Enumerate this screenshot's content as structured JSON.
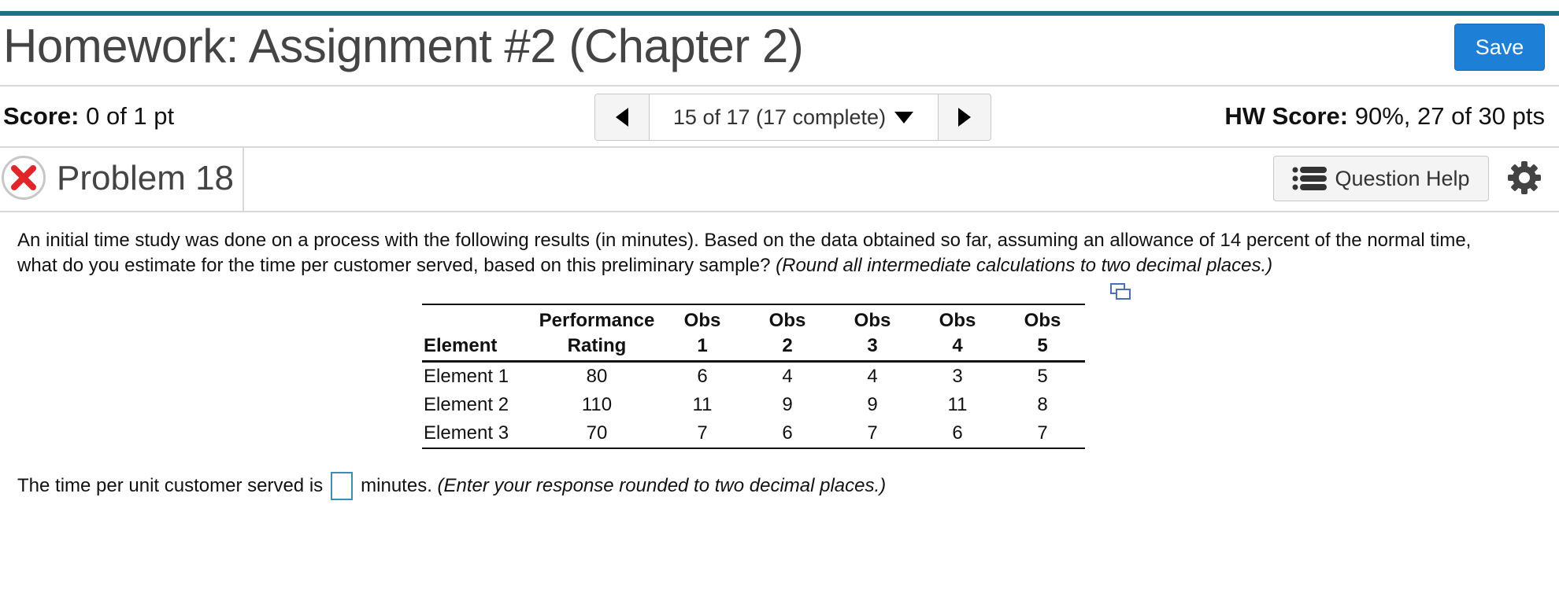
{
  "header": {
    "title": "Homework: Assignment #2 (Chapter 2)",
    "save_label": "Save"
  },
  "score": {
    "label": "Score:",
    "value": "0 of 1 pt"
  },
  "nav": {
    "position": "15 of 17 (17 complete)"
  },
  "hw_score": {
    "label": "HW Score:",
    "value": "90%, 27 of 30 pts"
  },
  "problem": {
    "title": "Problem 18",
    "help_label": "Question Help"
  },
  "question": {
    "text": "An initial time study was done on a process with the following results (in minutes). Based on the data obtained so far, assuming an allowance of 14 percent of the normal time, what do you estimate for the time per customer served, based on this preliminary sample? ",
    "instruction": "(Round all intermediate calculations to two decimal places.)"
  },
  "table": {
    "headers": {
      "element": "Element",
      "rating_top": "Performance",
      "rating_bottom": "Rating",
      "obs_top": "Obs",
      "obs_numbers": [
        "1",
        "2",
        "3",
        "4",
        "5"
      ]
    },
    "rows": [
      {
        "element": "Element 1",
        "rating": "80",
        "obs": [
          "6",
          "4",
          "4",
          "3",
          "5"
        ]
      },
      {
        "element": "Element 2",
        "rating": "110",
        "obs": [
          "11",
          "9",
          "9",
          "11",
          "8"
        ]
      },
      {
        "element": "Element 3",
        "rating": "70",
        "obs": [
          "7",
          "6",
          "7",
          "6",
          "7"
        ]
      }
    ]
  },
  "answer": {
    "prefix": "The time per unit customer served is",
    "suffix": "minutes.",
    "instruction": "(Enter your response rounded to two decimal places.)"
  },
  "colors": {
    "accent_strip": "#1c7089",
    "save_button": "#1e7fd6",
    "wrong_mark": "#e0262b"
  },
  "icons": [
    "prev-arrow-icon",
    "dropdown-caret-icon",
    "next-arrow-icon",
    "incorrect-x-icon",
    "list-icon",
    "gear-icon",
    "expand-icon"
  ]
}
